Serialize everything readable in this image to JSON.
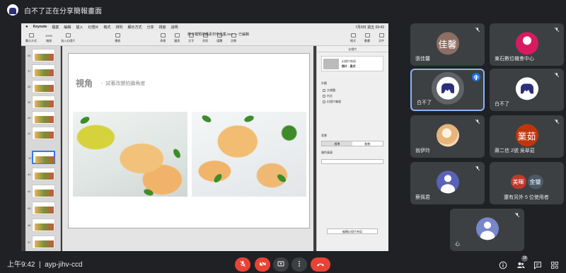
{
  "meeting": {
    "presenter_banner": "白不了正在分享簡報畫面",
    "time": "上午9:42",
    "code": "ayp-jihv-ccd",
    "participants_count": "18"
  },
  "shared_screen": {
    "app_menu": [
      "Keynote",
      "檔案",
      "編輯",
      "插入",
      "幻燈片",
      "格式",
      "排列",
      "顯示方式",
      "分享",
      "視窗",
      "說明"
    ],
    "clock": "7月9日 週五 09:43",
    "document_title": "柿子種類拍攝素材作品集.key — 已編輯",
    "toolbar_items": [
      "顯示方式",
      "縮放",
      "加入幻燈片",
      "播放",
      "表格",
      "圖表",
      "文字",
      "形狀",
      "媒體",
      "註解",
      "格式",
      "動畫",
      "文件"
    ],
    "zoom_value": "100%",
    "slide_numbers": [
      "36",
      "37",
      "38",
      "39",
      "40",
      "41",
      "42",
      "43",
      "44",
      "45",
      "46",
      "47",
      "48"
    ],
    "slide": {
      "title": "視角",
      "dash": "-",
      "subtitle": "試著改變拍攝角度"
    },
    "inspector": {
      "tab": "幻燈片",
      "layout_label": "幻燈片佈局",
      "layout_name": "照片 - 直式",
      "appearance": "外觀",
      "options": [
        "大標題",
        "內文",
        "幻燈片編號"
      ],
      "background": "背景",
      "seg": [
        "標準",
        "動態"
      ],
      "fill_label": "顏色填滿",
      "edit_button": "編輯幻燈片佈局"
    }
  },
  "tiles": [
    {
      "name": "張佳馨",
      "initials": "佳馨",
      "color": "#8d6e63",
      "muted": true
    },
    {
      "name": "東石數位機會中心",
      "initials": "",
      "color": "#d81b60",
      "muted": true
    },
    {
      "name": "白不了",
      "initials": "",
      "color": "#ffffff",
      "muted": false,
      "speaking": true
    },
    {
      "name": "白不了",
      "initials": "",
      "color": "#ffffff",
      "muted": true
    },
    {
      "name": "翁伊玲",
      "initials": "",
      "color": "#f5d7b5",
      "muted": true
    },
    {
      "name": "蔣二信 2號 吳翠茹",
      "initials": "業茹",
      "color": "#bf360c",
      "muted": true
    },
    {
      "name": "蔡佩君",
      "initials": "",
      "color": "#5a62b8",
      "muted": true
    },
    {
      "name": "還有另外 5 位使用者",
      "pair": [
        "美暉",
        "金鑾"
      ],
      "pair_colors": [
        "#c0392b",
        "#4a5a6a"
      ]
    },
    {
      "name": "心",
      "initials": "",
      "color": "#7986cb",
      "muted": true
    }
  ]
}
